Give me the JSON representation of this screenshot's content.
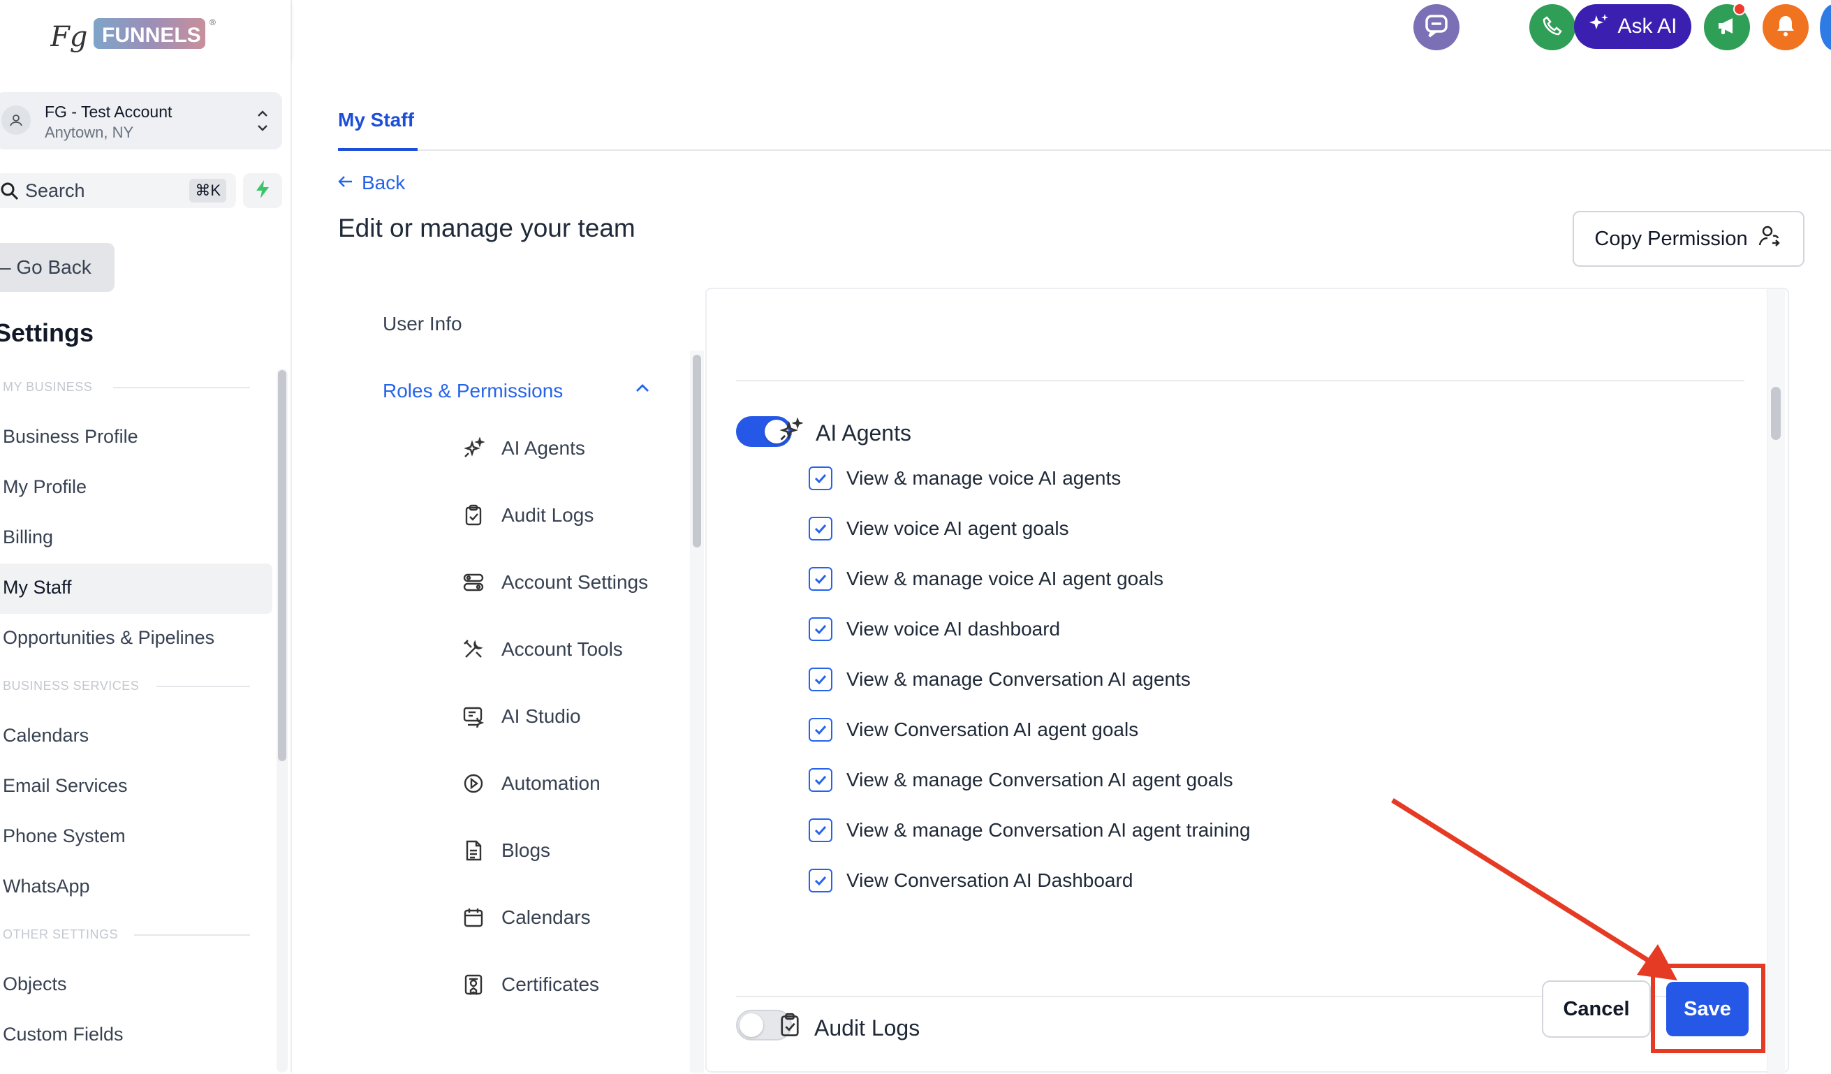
{
  "brand": {
    "logo_text": "FUNNELS",
    "logo_mark": "FG"
  },
  "account": {
    "name": "FG - Test Account",
    "location": "Anytown, NY"
  },
  "search": {
    "label": "Search",
    "shortcut": "⌘K"
  },
  "sidebar": {
    "go_back": "Go Back",
    "title": "Settings",
    "sections": [
      {
        "heading": "MY BUSINESS",
        "items": [
          "Business Profile",
          "My Profile",
          "Billing",
          "My Staff",
          "Opportunities & Pipelines"
        ]
      },
      {
        "heading": "BUSINESS SERVICES",
        "items": [
          "Calendars",
          "Email Services",
          "Phone System",
          "WhatsApp"
        ]
      },
      {
        "heading": "OTHER SETTINGS",
        "items": [
          "Objects",
          "Custom Fields"
        ]
      }
    ],
    "active_item": "My Staff"
  },
  "topbar": {
    "ask_ai": "Ask AI"
  },
  "main": {
    "tab": "My Staff",
    "back": "Back",
    "heading": "Edit or manage your team",
    "copy_permission": "Copy Permission"
  },
  "subnav": {
    "user_info": "User Info",
    "roles": "Roles & Permissions",
    "items": [
      {
        "label": "AI Agents",
        "icon": "sparkles-icon"
      },
      {
        "label": "Audit Logs",
        "icon": "clipboard-check-icon"
      },
      {
        "label": "Account Settings",
        "icon": "settings-toggles-icon"
      },
      {
        "label": "Account Tools",
        "icon": "tools-icon"
      },
      {
        "label": "AI Studio",
        "icon": "ai-studio-icon"
      },
      {
        "label": "Automation",
        "icon": "play-circle-icon"
      },
      {
        "label": "Blogs",
        "icon": "document-icon"
      },
      {
        "label": "Calendars",
        "icon": "calendar-icon"
      },
      {
        "label": "Certificates",
        "icon": "certificate-icon"
      }
    ]
  },
  "permissions": {
    "groups": [
      {
        "title": "AI Agents",
        "enabled": true,
        "items": [
          {
            "label": "View & manage voice AI agents",
            "checked": true
          },
          {
            "label": "View voice AI agent goals",
            "checked": true
          },
          {
            "label": "View & manage voice AI agent goals",
            "checked": true
          },
          {
            "label": "View voice AI dashboard",
            "checked": true
          },
          {
            "label": "View & manage Conversation AI agents",
            "checked": true
          },
          {
            "label": "View Conversation AI agent goals",
            "checked": true
          },
          {
            "label": "View & manage Conversation AI agent goals",
            "checked": true
          },
          {
            "label": "View & manage Conversation AI agent training",
            "checked": true
          },
          {
            "label": "View Conversation AI Dashboard",
            "checked": true
          }
        ]
      },
      {
        "title": "Audit Logs",
        "enabled": false,
        "items": []
      }
    ]
  },
  "actions": {
    "cancel": "Cancel",
    "save": "Save"
  },
  "colors": {
    "accent": "#2558e6",
    "link": "#2563eb",
    "ask_ai": "#3b1fb0",
    "annotation": "#e53a24",
    "phone": "#2f9e57",
    "notify": "#f0731f"
  }
}
